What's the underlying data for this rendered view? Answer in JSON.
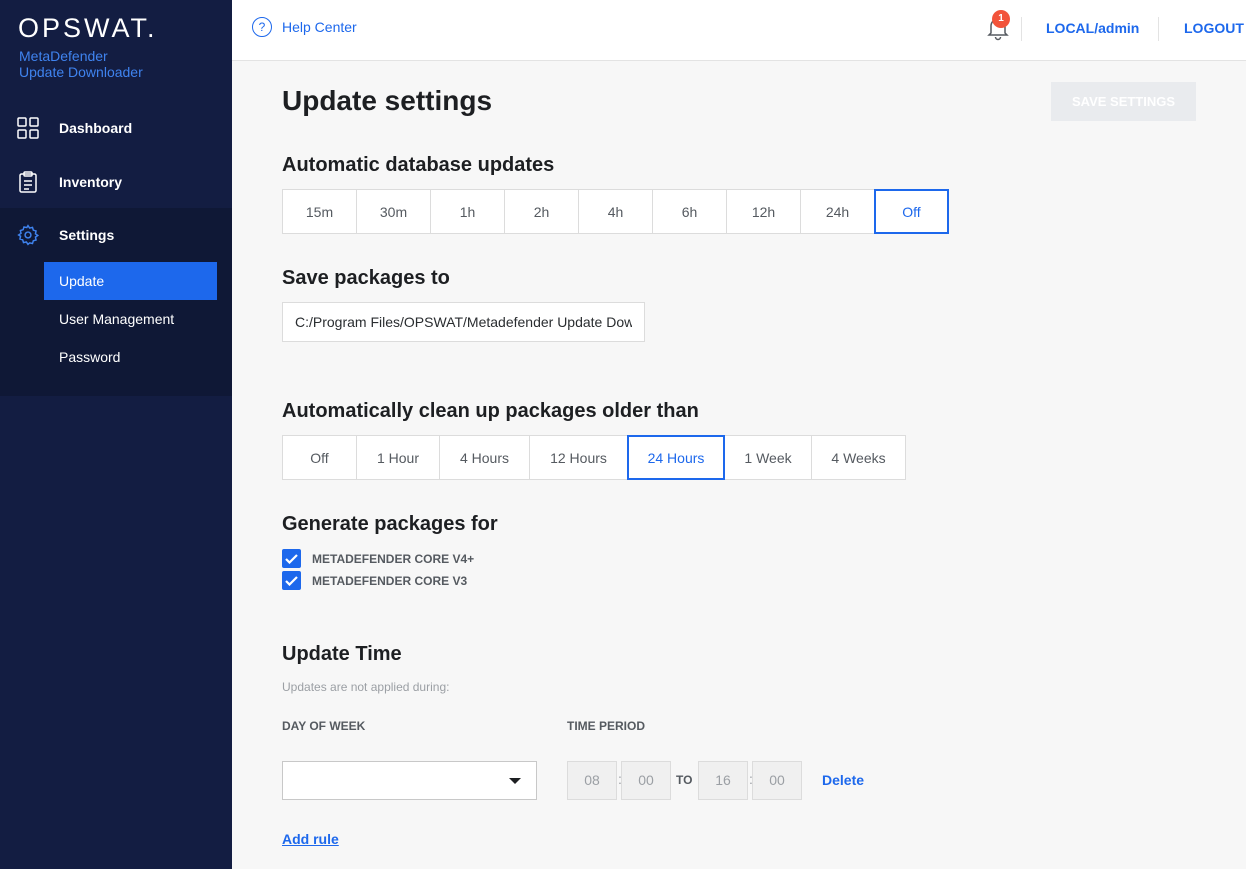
{
  "brand": {
    "logo": "OPSWAT.",
    "product_line1": "MetaDefender",
    "product_line2": "Update Downloader"
  },
  "sidebar": {
    "items": [
      {
        "label": "Dashboard",
        "icon": "dashboard-grid-icon"
      },
      {
        "label": "Inventory",
        "icon": "clipboard-icon"
      },
      {
        "label": "Settings",
        "icon": "gear-icon"
      }
    ],
    "settings_sub": [
      {
        "label": "Update",
        "active": true
      },
      {
        "label": "User Management",
        "active": false
      },
      {
        "label": "Password",
        "active": false
      }
    ]
  },
  "topbar": {
    "help_icon": "question-circle-icon",
    "help_label": "Help Center",
    "bell_icon": "bell-icon",
    "notification_count": "1",
    "user_label": "LOCAL/admin",
    "logout_label": "LOGOUT"
  },
  "page": {
    "title": "Update settings",
    "save_label": "SAVE SETTINGS"
  },
  "auto_updates": {
    "title": "Automatic database updates",
    "options": [
      "15m",
      "30m",
      "1h",
      "2h",
      "4h",
      "6h",
      "12h",
      "24h",
      "Off"
    ],
    "selected": "Off"
  },
  "save_packages": {
    "title": "Save packages to",
    "value": "C:/Program Files/OPSWAT/Metadefender Update Dow"
  },
  "cleanup": {
    "title": "Automatically clean up packages older than",
    "options": [
      "Off",
      "1 Hour",
      "4 Hours",
      "12 Hours",
      "24 Hours",
      "1 Week",
      "4 Weeks"
    ],
    "selected": "24 Hours"
  },
  "generate": {
    "title": "Generate packages for",
    "items": [
      {
        "label": "METADEFENDER CORE V4+",
        "checked": true
      },
      {
        "label": "METADEFENDER CORE V3",
        "checked": true
      }
    ]
  },
  "update_time": {
    "title": "Update Time",
    "hint": "Updates are not applied during:",
    "day_label": "DAY OF WEEK",
    "period_label": "TIME PERIOD",
    "day_value": "",
    "from_hour": "08",
    "from_min": "00",
    "to_label": "TO",
    "to_hour": "16",
    "to_min": "00",
    "delete_label": "Delete",
    "add_rule_label": "Add rule"
  },
  "colors": {
    "accent": "#1d68ec",
    "sidebar": "#131d42",
    "badge": "#f2533a"
  }
}
